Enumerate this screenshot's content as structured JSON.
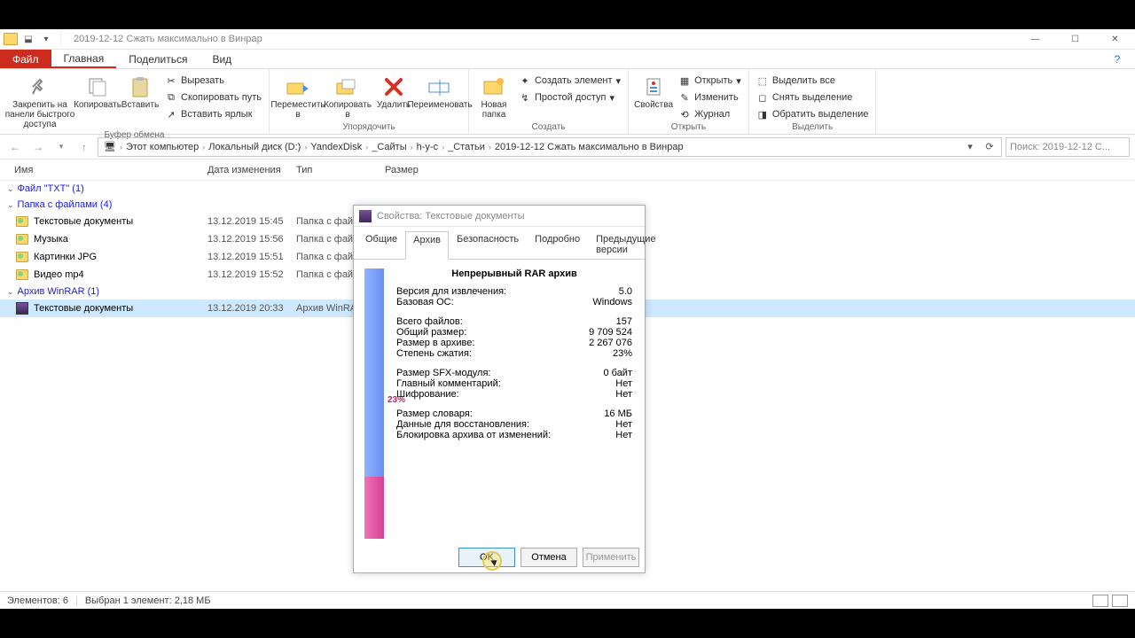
{
  "window": {
    "title": "2019-12-12 Сжать максимально в Винрар"
  },
  "tabs": {
    "file": "Файл",
    "home": "Главная",
    "share": "Поделиться",
    "view": "Вид"
  },
  "ribbon": {
    "clipboard": {
      "pin": "Закрепить на панели быстрого доступа",
      "copy": "Копировать",
      "paste": "Вставить",
      "cut": "Вырезать",
      "copypath": "Скопировать путь",
      "pasteshortcut": "Вставить ярлык",
      "group": "Буфер обмена"
    },
    "organize": {
      "moveto": "Переместить в",
      "copyto": "Копировать в",
      "delete": "Удалить",
      "rename": "Переименовать",
      "group": "Упорядочить"
    },
    "new": {
      "newfolder": "Новая папка",
      "newitem": "Создать элемент",
      "easyaccess": "Простой доступ",
      "group": "Создать"
    },
    "open": {
      "properties": "Свойства",
      "open": "Открыть",
      "edit": "Изменить",
      "history": "Журнал",
      "group": "Открыть"
    },
    "select": {
      "selectall": "Выделить все",
      "selectnone": "Снять выделение",
      "invert": "Обратить выделение",
      "group": "Выделить"
    }
  },
  "breadcrumb": [
    "Этот компьютер",
    "Локальный диск (D:)",
    "YandexDisk",
    "_Сайты",
    "h-y-c",
    "_Статьи",
    "2019-12-12 Сжать максимально в Винрар"
  ],
  "search_placeholder": "Поиск: 2019-12-12 С...",
  "columns": {
    "name": "Имя",
    "date": "Дата изменения",
    "type": "Тип",
    "size": "Размер"
  },
  "groups": [
    {
      "header": "Файл \"TXT\" (1)",
      "rows": []
    },
    {
      "header": "Папка с файлами (4)",
      "rows": [
        {
          "icon": "folder",
          "name": "Текстовые документы",
          "date": "13.12.2019 15:45",
          "type": "Папка с файлами"
        },
        {
          "icon": "folder",
          "name": "Музыка",
          "date": "13.12.2019 15:56",
          "type": "Папка с файл"
        },
        {
          "icon": "folder",
          "name": "Картинки JPG",
          "date": "13.12.2019 15:51",
          "type": "Папка с файл"
        },
        {
          "icon": "folder",
          "name": "Видео mp4",
          "date": "13.12.2019 15:52",
          "type": "Папка с файл"
        }
      ]
    },
    {
      "header": "Архив WinRAR (1)",
      "rows": [
        {
          "icon": "rar",
          "name": "Текстовые документы",
          "date": "13.12.2019 20:33",
          "type": "Архив WinRAR",
          "selected": true
        }
      ]
    }
  ],
  "status": {
    "left": "Элементов: 6",
    "mid": "Выбран 1 элемент: 2,18 МБ"
  },
  "dialog": {
    "title": "Свойства: Текстовые документы",
    "tabs": [
      "Общие",
      "Архив",
      "Безопасность",
      "Подробно",
      "Предыдущие версии"
    ],
    "active_tab": 1,
    "header": "Непрерывный RAR архив",
    "rows": [
      {
        "k": "Версия для извлечения:",
        "v": "5.0"
      },
      {
        "k": "Базовая ОС:",
        "v": "Windows"
      },
      {
        "gap": true,
        "k": "Всего файлов:",
        "v": "157"
      },
      {
        "k": "Общий размер:",
        "v": "9 709 524"
      },
      {
        "k": "Размер в архиве:",
        "v": "2 267 076"
      },
      {
        "k": "Степень сжатия:",
        "v": "23%"
      },
      {
        "gap": true,
        "k": "Размер SFX-модуля:",
        "v": "0 байт"
      },
      {
        "k": "Главный комментарий:",
        "v": "Нет"
      },
      {
        "k": "Шифрование:",
        "v": "Нет"
      },
      {
        "gap": true,
        "k": "Размер словаря:",
        "v": "16 МБ"
      },
      {
        "k": "Данные для восстановления:",
        "v": "Нет"
      },
      {
        "k": "Блокировка архива от изменений:",
        "v": "Нет"
      }
    ],
    "ratio_label": "23%",
    "ratio_percent": 23,
    "buttons": {
      "ok": "OK",
      "cancel": "Отмена",
      "apply": "Применить"
    }
  }
}
